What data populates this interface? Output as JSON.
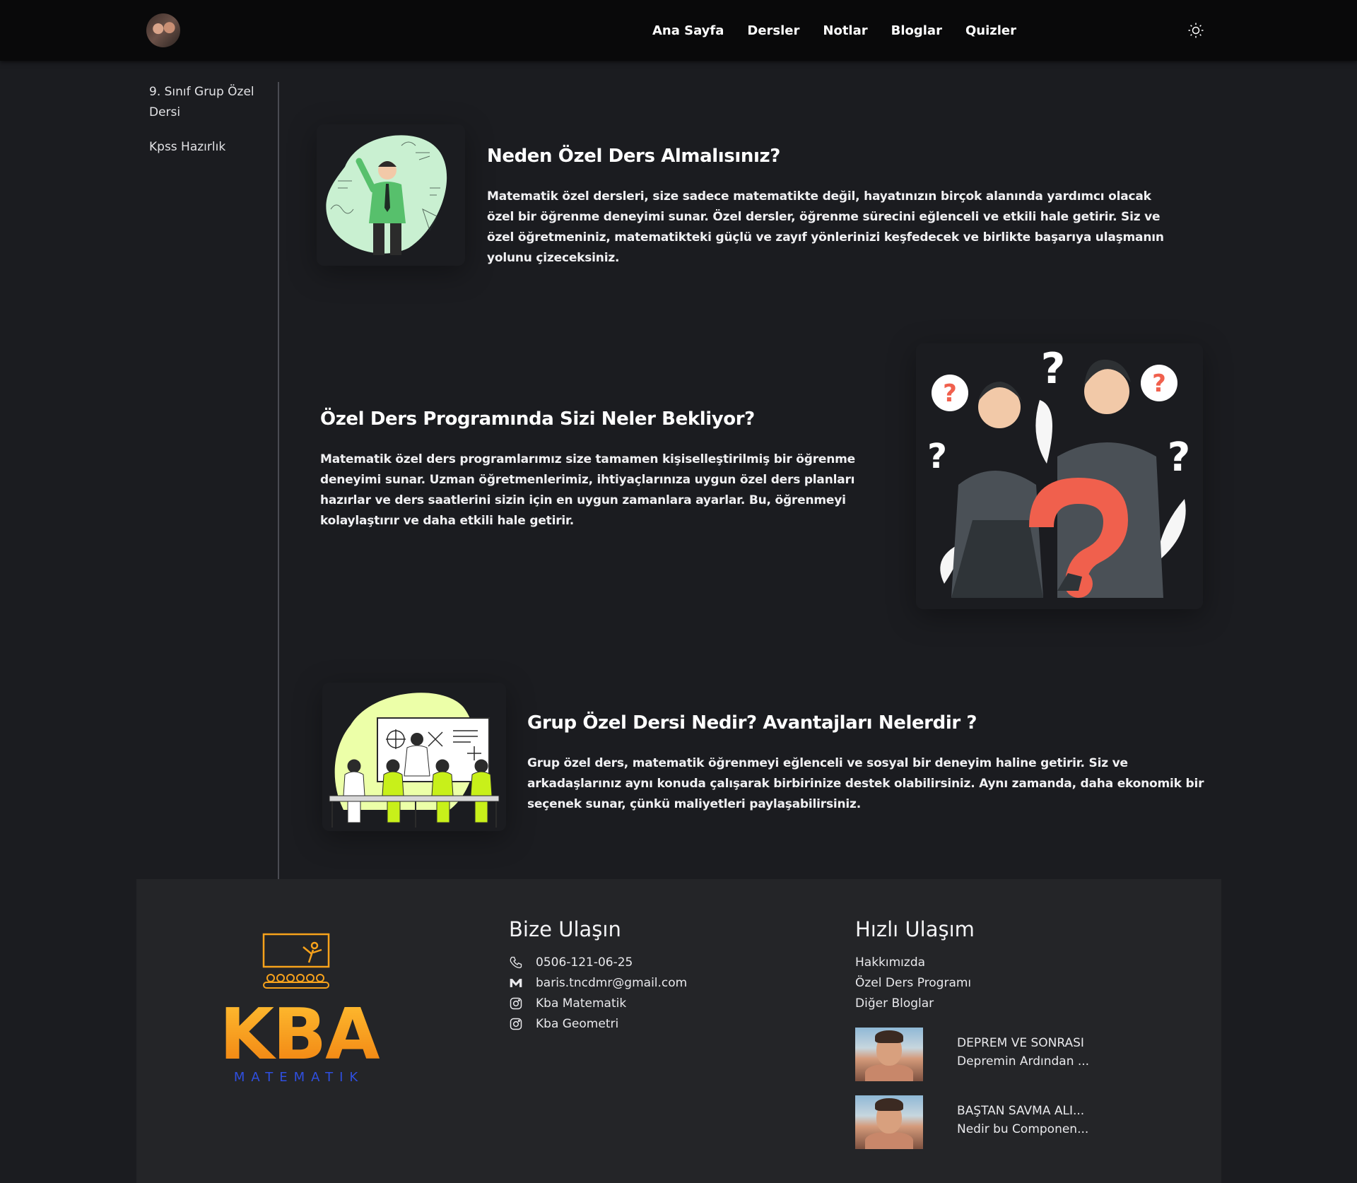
{
  "nav": {
    "links": [
      "Ana Sayfa",
      "Dersler",
      "Notlar",
      "Bloglar",
      "Quizler"
    ],
    "theme_icon": "sun-icon"
  },
  "sidebar": {
    "items": [
      {
        "label": "9. Sınıf Grup Özel Dersi"
      },
      {
        "label": "Kpss Hazırlık"
      }
    ]
  },
  "sections": [
    {
      "title": "Neden Özel Ders Almalısınız?",
      "text": "Matematik özel dersleri, size sadece matematikte değil, hayatınızın birçok alanında yardımcı olacak özel bir öğrenme deneyimi sunar. Özel dersler, öğrenme sürecini eğlenceli ve etkili hale getirir. Siz ve özel öğretmeniniz, matematikteki güçlü ve zayıf yönlerinizi keşfedecek ve birlikte başarıya ulaşmanın yolunu çizeceksiniz."
    },
    {
      "title": "Özel Ders Programında Sizi Neler Bekliyor?",
      "text": "Matematik özel ders programlarımız size tamamen kişiselleştirilmiş bir öğrenme deneyimi sunar. Uzman öğretmenlerimiz, ihtiyaçlarınıza uygun özel ders planları hazırlar ve ders saatlerini sizin için en uygun zamanlara ayarlar. Bu, öğrenmeyi kolaylaştırır ve daha etkili hale getirir."
    },
    {
      "title": "Grup Özel Dersi Nedir? Avantajları Nelerdir ?",
      "text": "Grup özel ders, matematik öğrenmeyi eğlenceli ve sosyal bir deneyim haline getirir. Siz ve arkadaşlarınız aynı konuda çalışarak birbirinize destek olabilirsiniz. Aynı zamanda, daha ekonomik bir seçenek sunar, çünkü maliyetleri paylaşabilirsiniz."
    }
  ],
  "footer": {
    "logo_text": "KBA",
    "logo_sub": "MATEMATIK",
    "contact": {
      "title": "Bize Ulaşın",
      "items": [
        {
          "icon": "phone-icon",
          "label": "0506-121-06-25"
        },
        {
          "icon": "mail-icon",
          "label": "baris.tncdmr@gmail.com"
        },
        {
          "icon": "instagram-icon",
          "label": "Kba Matematik"
        },
        {
          "icon": "instagram-icon",
          "label": "Kba Geometri"
        }
      ]
    },
    "quick": {
      "title": "Hızlı Ulaşım",
      "links": [
        "Hakkımızda",
        "Özel Ders Programı",
        "Diğer Bloglar"
      ],
      "blogs": [
        {
          "title": "DEPREM VE SONRASI",
          "subtitle": "Depremin Ardından ..."
        },
        {
          "title": "BAŞTAN SAVMA ALI...",
          "subtitle": "Nedir bu Componen..."
        }
      ]
    }
  },
  "colors": {
    "background": "#1b1c20",
    "navbar": "#09090a",
    "footer": "#242528",
    "logo_orange": "#f7a21b",
    "logo_blue": "#2f4fe0",
    "question_red": "#f0604d",
    "blob_green": "#c9f0d1",
    "blob_lime": "#ecffa8"
  }
}
